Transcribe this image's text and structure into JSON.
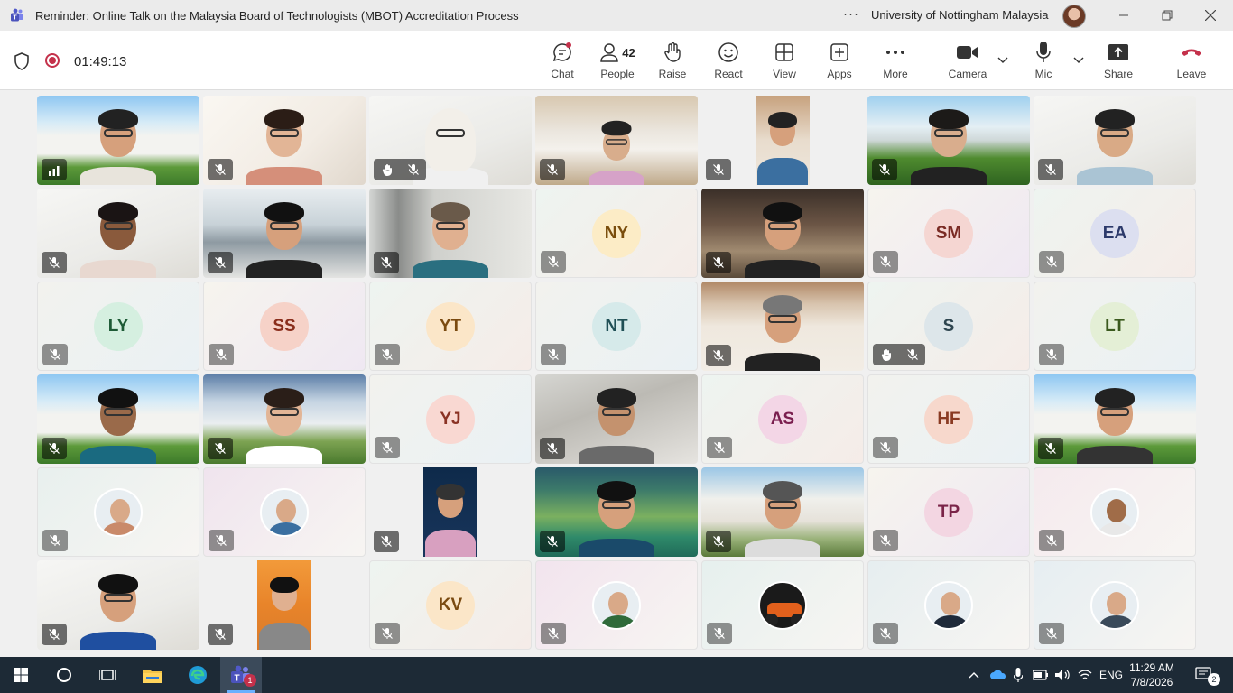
{
  "window": {
    "title": "Reminder: Online Talk on the Malaysia Board of Technologists (MBOT) Accreditation Process",
    "org": "University of Nottingham Malaysia",
    "more": "···",
    "app_icon": "teams-icon",
    "controls": [
      "minimize",
      "restore",
      "close"
    ]
  },
  "meeting": {
    "timer": "01:49:13",
    "people_count": "42",
    "recording": true,
    "buttons": {
      "chat": "Chat",
      "people": "People",
      "raise": "Raise",
      "react": "React",
      "view": "View",
      "apps": "Apps",
      "more": "More",
      "camera": "Camera",
      "mic": "Mic",
      "share": "Share",
      "leave": "Leave"
    }
  },
  "participants": [
    {
      "kind": "video",
      "scene": "campus",
      "shirt": "#e8e4dc",
      "skin": "#d6a07c",
      "hair": "#222",
      "signal": true
    },
    {
      "kind": "video",
      "scene": "room-light",
      "shirt": "#d58f7a",
      "skin": "#e2b596",
      "hair": "#2b1d16"
    },
    {
      "kind": "video",
      "scene": "white",
      "shirt": "#f0f0f0",
      "skin": "#d8ad8c",
      "hair": "#f2efe9",
      "hijab": true,
      "hand": true
    },
    {
      "kind": "video",
      "scene": "interior",
      "shirt": "#d6a2c8",
      "skin": "#d8ad8c",
      "hair": "#222",
      "small": true
    },
    {
      "kind": "narrow",
      "scene": "door",
      "shirt": "#3b6fa0",
      "skin": "#d6a07c",
      "hair": "#222"
    },
    {
      "kind": "video",
      "scene": "campus-trees",
      "shirt": "#222",
      "skin": "#d9ad8d",
      "hair": "#1c1a18"
    },
    {
      "kind": "video",
      "scene": "white",
      "shirt": "#aac4d4",
      "skin": "#d9aa86",
      "hair": "#222"
    },
    {
      "kind": "video",
      "scene": "white",
      "shirt": "#e8d8d0",
      "skin": "#8a5a3c",
      "hair": "#1a1414",
      "dark": true
    },
    {
      "kind": "video",
      "scene": "windows",
      "shirt": "#222",
      "skin": "#d6a07c",
      "hair": "#111"
    },
    {
      "kind": "video",
      "scene": "wall",
      "shirt": "#2a6f80",
      "skin": "#e0b090",
      "hair": "#6a5a4a"
    },
    {
      "kind": "avatar",
      "initials": "NY",
      "bg": "#fcecc6",
      "fg": "#7a4d0c"
    },
    {
      "kind": "video",
      "scene": "cafe",
      "shirt": "#222",
      "skin": "#d6a07c",
      "hair": "#111"
    },
    {
      "kind": "avatar",
      "initials": "SM",
      "bg": "#f5d6d2",
      "fg": "#7a2b24"
    },
    {
      "kind": "avatar",
      "initials": "EA",
      "bg": "#dcdff0",
      "fg": "#2d3a6b"
    },
    {
      "kind": "avatar",
      "initials": "LY",
      "bg": "#d5efe0",
      "fg": "#1e5b36"
    },
    {
      "kind": "avatar",
      "initials": "SS",
      "bg": "#f6d2c8",
      "fg": "#8a2e1c"
    },
    {
      "kind": "avatar",
      "initials": "YT",
      "bg": "#fbe6c8",
      "fg": "#7a4a10"
    },
    {
      "kind": "avatar",
      "initials": "NT",
      "bg": "#d6eaea",
      "fg": "#1f4f55"
    },
    {
      "kind": "video",
      "scene": "wood",
      "shirt": "#222",
      "skin": "#d6a07c",
      "hair": "#777"
    },
    {
      "kind": "avatar",
      "initials": "S",
      "bg": "#dde6ea",
      "fg": "#2f4650",
      "hand": true
    },
    {
      "kind": "avatar",
      "initials": "LT",
      "bg": "#e4efd6",
      "fg": "#3b5a1e"
    },
    {
      "kind": "video",
      "scene": "campus",
      "shirt": "#1a6a80",
      "skin": "#9a6a4a",
      "hair": "#111",
      "dark": true
    },
    {
      "kind": "video",
      "scene": "campus-building",
      "shirt": "#fff",
      "skin": "#e2b596",
      "hair": "#2a1e18"
    },
    {
      "kind": "avatar",
      "initials": "YJ",
      "bg": "#f9d8d2",
      "fg": "#8a3224"
    },
    {
      "kind": "video",
      "scene": "blur",
      "shirt": "#6a6a6a",
      "skin": "#c4926e",
      "hair": "#222"
    },
    {
      "kind": "avatar",
      "initials": "AS",
      "bg": "#f3d6e6",
      "fg": "#7a1f4f"
    },
    {
      "kind": "avatar",
      "initials": "HF",
      "bg": "#f7d8cc",
      "fg": "#8a3a22"
    },
    {
      "kind": "video",
      "scene": "campus",
      "shirt": "#333",
      "skin": "#d6a07c",
      "hair": "#222"
    },
    {
      "kind": "photo",
      "shirt": "#c98a6a",
      "bg": "#e8f0ee"
    },
    {
      "kind": "photo",
      "shirt": "#3b6fa0",
      "bg": "#f0e4ee"
    },
    {
      "kind": "narrow",
      "scene": "navy",
      "shirt": "#d8a0c0",
      "skin": "#d6a07c",
      "hair": "#333"
    },
    {
      "kind": "video",
      "scene": "lake",
      "shirt": "#1a4a6a",
      "skin": "#d6a07c",
      "hair": "#111"
    },
    {
      "kind": "video",
      "scene": "white-building",
      "shirt": "#dcdcdc",
      "skin": "#d6a07c",
      "hair": "#555"
    },
    {
      "kind": "avatar",
      "initials": "TP",
      "bg": "#f3d6e2",
      "fg": "#7a2448"
    },
    {
      "kind": "photo",
      "shirt": "#e8e8e8",
      "bg": "#f5eaee",
      "dark": true
    },
    {
      "kind": "video",
      "scene": "white",
      "shirt": "#1f4fa0",
      "skin": "#d6a07c",
      "hair": "#111"
    },
    {
      "kind": "narrow",
      "scene": "orange",
      "shirt": "#888",
      "skin": "#e0b090",
      "hair": "#111"
    },
    {
      "kind": "avatar",
      "initials": "KV",
      "bg": "#fbe6c8",
      "fg": "#7a4a10"
    },
    {
      "kind": "photo",
      "shirt": "#2f6a3a",
      "bg": "#f2e4ee"
    },
    {
      "kind": "photo",
      "shirt": "#d8501c",
      "bg": "#e6f0ee",
      "bike": true
    },
    {
      "kind": "photo",
      "shirt": "#1f2a3a",
      "bg": "#e6eef0"
    },
    {
      "kind": "photo",
      "shirt": "#3a4a5a",
      "bg": "#e6eef2"
    }
  ],
  "taskbar": {
    "apps": [
      "windows-start-icon",
      "search-icon",
      "task-view-icon",
      "file-explorer-icon",
      "edge-icon",
      "teams-icon"
    ],
    "teams_badge": "1",
    "lang": "ENG",
    "time": "11:29 AM",
    "date": "7/8/2026",
    "notifications": "2"
  }
}
